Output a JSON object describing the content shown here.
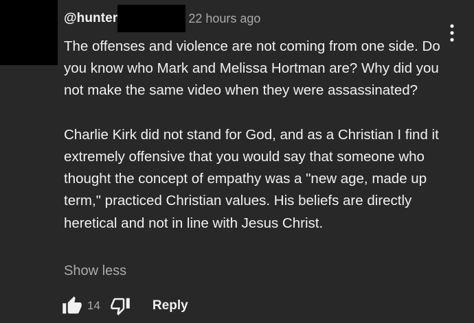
{
  "comment": {
    "author": "@hunter",
    "timestamp": "22 hours ago",
    "paragraphs": [
      "The offenses and violence are not coming from one side. Do you know who Mark and Melissa Hortman are? Why did you not make the same video when they were assassinated?",
      "Charlie Kirk did not stand for God, and as a Christian I find it extremely offensive that you would say that someone who thought the concept of empathy was a \"new age, made up term,\" practiced Christian values. His beliefs are directly heretical and not in line with Jesus Christ."
    ],
    "show_less_label": "Show less",
    "like_count": "14",
    "reply_label": "Reply"
  },
  "icons": {
    "menu": "more-vert-icon",
    "like": "thumb-up-filled-icon",
    "dislike": "thumb-down-outline-icon"
  },
  "colors": {
    "background": "#282828",
    "text_primary": "#f1f1f1",
    "text_secondary": "#aaaaaa",
    "redaction": "#000000"
  }
}
